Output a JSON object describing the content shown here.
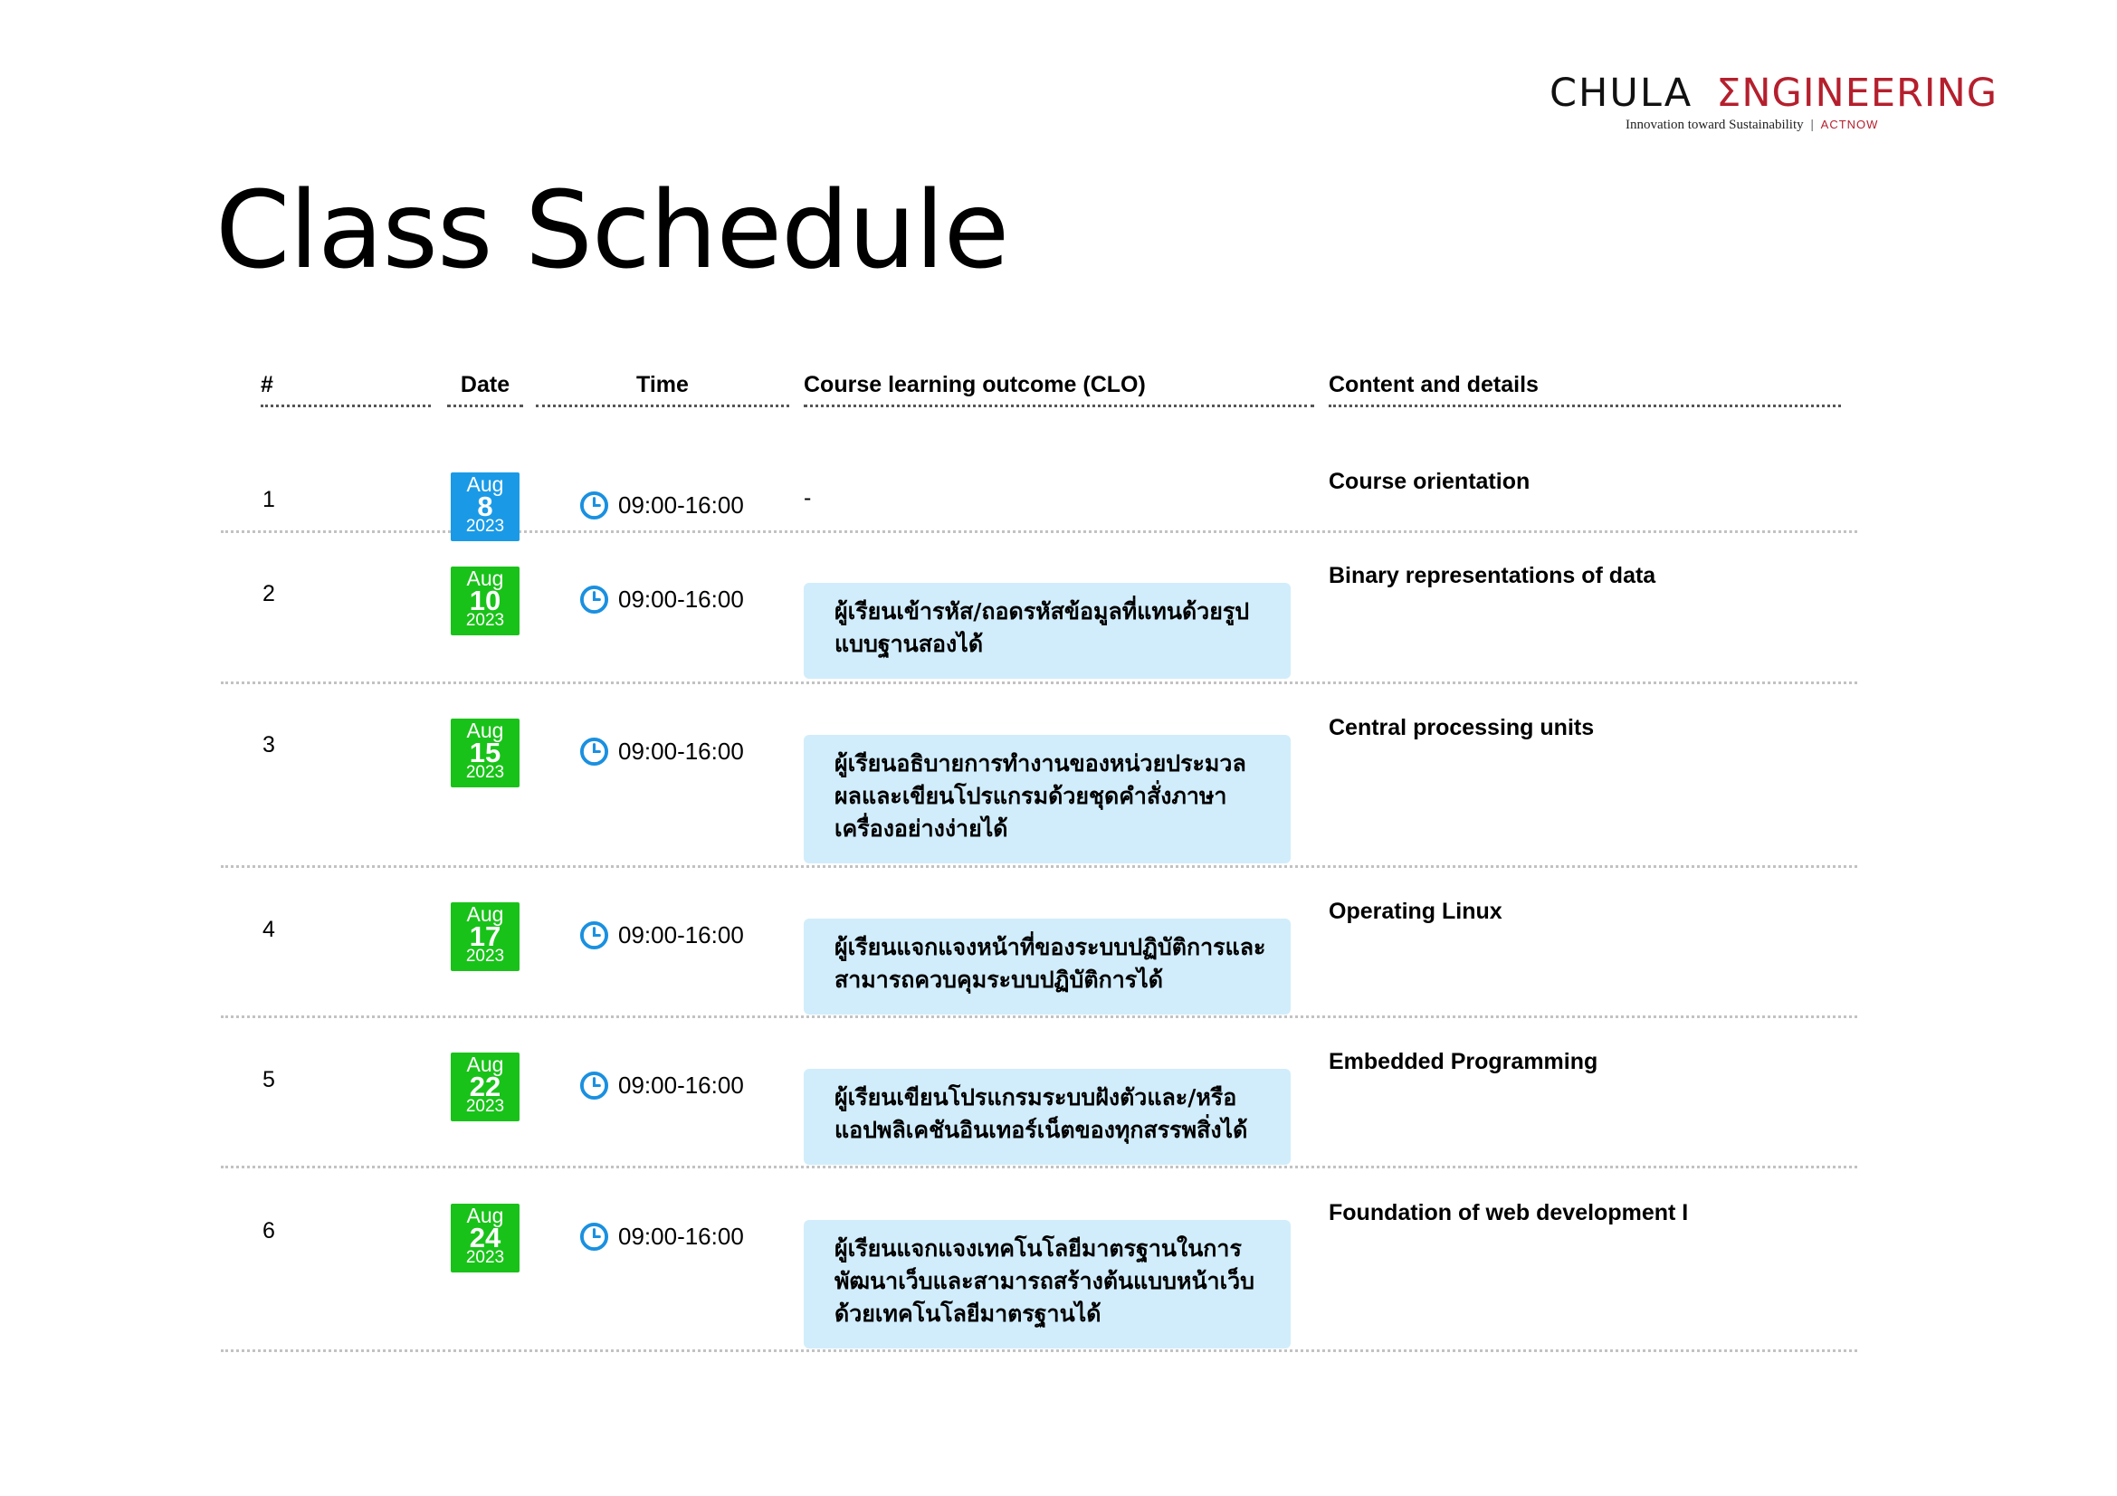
{
  "logo": {
    "chula": "CHULA",
    "engineering": "ΣNGINEERING",
    "tagline": "Innovation toward Sustainability",
    "separator": "|",
    "actnow": "ACTNOW"
  },
  "title": "Class Schedule",
  "table": {
    "headers": {
      "num": "#",
      "date": "Date",
      "time": "Time",
      "clo": "Course learning outcome (CLO)",
      "content": "Content and details"
    },
    "rows": [
      {
        "num": "1",
        "month": "Aug",
        "day": "8",
        "year": "2023",
        "time": "09:00-16:00",
        "clo": "-",
        "content": "Course orientation"
      },
      {
        "num": "2",
        "month": "Aug",
        "day": "10",
        "year": "2023",
        "time": "09:00-16:00",
        "clo": "ผู้เรียนเข้ารหัส/ถอดรหัสข้อมูลที่แทนด้วยรูปแบบฐานสองได้",
        "content": "Binary representations of data"
      },
      {
        "num": "3",
        "month": "Aug",
        "day": "15",
        "year": "2023",
        "time": "09:00-16:00",
        "clo": "ผู้เรียนอธิบายการทำงานของหน่วยประมวลผลและเขียนโปรแกรมด้วยชุดคำสั่งภาษาเครื่องอย่างง่ายได้",
        "content": "Central processing units"
      },
      {
        "num": "4",
        "month": "Aug",
        "day": "17",
        "year": "2023",
        "time": "09:00-16:00",
        "clo": "ผู้เรียนแจกแจงหน้าที่ของระบบปฏิบัติการและสามารถควบคุมระบบปฏิบัติการได้",
        "content": "Operating Linux"
      },
      {
        "num": "5",
        "month": "Aug",
        "day": "22",
        "year": "2023",
        "time": "09:00-16:00",
        "clo": "ผู้เรียนเขียนโปรแกรมระบบฝังตัวและ/หรือแอปพลิเคชันอินเทอร์เน็ตของทุกสรรพสิ่งได้",
        "content": "Embedded Programming"
      },
      {
        "num": "6",
        "month": "Aug",
        "day": "24",
        "year": "2023",
        "time": "09:00-16:00",
        "clo": "ผู้เรียนแจกแจงเทคโนโลยีมาตรฐานในการพัฒนาเว็บและสามารถสร้างต้นแบบหน้าเว็บด้วยเทคโนโลยีมาตรฐานได้",
        "content": "Foundation of web development I"
      }
    ]
  },
  "colors": {
    "calendar_first": "#1a9ae6",
    "calendar_rest": "#19c219",
    "clock_icon": "#1a90e0",
    "clo_box": "#d1edfb",
    "brand_red": "#b51f2d"
  }
}
